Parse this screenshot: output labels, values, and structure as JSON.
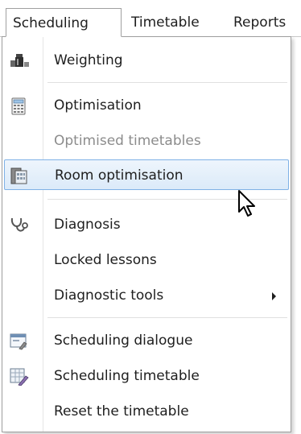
{
  "menubar": {
    "tabs": [
      {
        "label": "Scheduling",
        "active": true
      },
      {
        "label": "Timetable",
        "active": false
      },
      {
        "label": "Reports",
        "active": false
      }
    ]
  },
  "menu": {
    "items": [
      {
        "label": "Weighting",
        "icon": "weighting-icon",
        "enabled": true
      },
      {
        "label": "Optimisation",
        "icon": "calculator-icon",
        "enabled": true
      },
      {
        "label": "Optimised timetables",
        "icon": null,
        "enabled": false
      },
      {
        "label": "Room optimisation",
        "icon": "room-optimisation-icon",
        "enabled": true,
        "highlighted": true
      },
      {
        "label": "Diagnosis",
        "icon": "stethoscope-icon",
        "enabled": true
      },
      {
        "label": "Locked lessons",
        "icon": null,
        "enabled": true
      },
      {
        "label": "Diagnostic tools",
        "icon": null,
        "enabled": true,
        "submenu": true
      },
      {
        "label": "Scheduling dialogue",
        "icon": "scheduling-dialogue-icon",
        "enabled": true
      },
      {
        "label": "Scheduling timetable",
        "icon": "scheduling-timetable-icon",
        "enabled": true
      },
      {
        "label": "Reset the timetable",
        "icon": null,
        "enabled": true
      }
    ]
  },
  "colors": {
    "highlight_border": "#7fb1e6",
    "highlight_fill": "#dbeaf9",
    "disabled_text": "#8c8c8c"
  }
}
